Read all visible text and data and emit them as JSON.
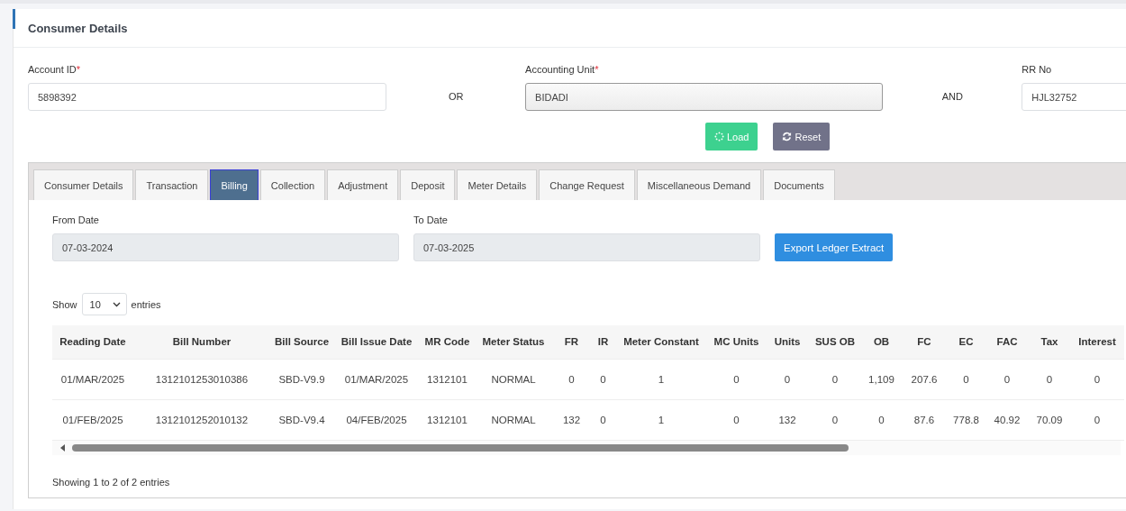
{
  "card": {
    "title": "Consumer Details"
  },
  "form": {
    "account_id": {
      "label": "Account ID",
      "required_mark": "*",
      "value": "5898392"
    },
    "or_text": "OR",
    "accounting_unit": {
      "label": "Accounting Unit",
      "required_mark": "*",
      "value": "BIDADI"
    },
    "and_text": "AND",
    "rr_no": {
      "label": "RR No",
      "value": "HJL32752"
    },
    "buttons": [
      {
        "kind": "load",
        "label": "Load"
      },
      {
        "kind": "reset",
        "label": "Reset"
      }
    ]
  },
  "tabs": [
    {
      "label": "Consumer Details",
      "selected": false
    },
    {
      "label": "Transaction",
      "selected": false
    },
    {
      "label": "Billing",
      "selected": true
    },
    {
      "label": "Collection",
      "selected": false
    },
    {
      "label": "Adjustment",
      "selected": false
    },
    {
      "label": "Deposit",
      "selected": false
    },
    {
      "label": "Meter Details",
      "selected": false
    },
    {
      "label": "Change Request",
      "selected": false
    },
    {
      "label": "Miscellaneous Demand",
      "selected": false
    },
    {
      "label": "Documents",
      "selected": false
    }
  ],
  "filters": {
    "from_date": {
      "label": "From Date",
      "value": "07-03-2024"
    },
    "to_date": {
      "label": "To Date",
      "value": "07-03-2025"
    },
    "export_button": "Export Ledger Extract"
  },
  "length_menu": {
    "show": "Show",
    "value": "10",
    "entries": "entries"
  },
  "table": {
    "columns": [
      "Reading Date",
      "Bill Number",
      "Bill Source",
      "Bill Issue Date",
      "MR Code",
      "Meter Status",
      "FR",
      "IR",
      "Meter Constant",
      "MC Units",
      "Units",
      "SUS OB",
      "OB",
      "FC",
      "EC",
      "FAC",
      "Tax",
      "Interest"
    ],
    "rows": [
      [
        "01/MAR/2025",
        "1312101253010386",
        "SBD-V9.9",
        "01/MAR/2025",
        "1312101",
        "NORMAL",
        "0",
        "0",
        "1",
        "0",
        "0",
        "0",
        "1,109",
        "207.6",
        "0",
        "0",
        "0",
        "0"
      ],
      [
        "01/FEB/2025",
        "1312101252010132",
        "SBD-V9.4",
        "04/FEB/2025",
        "1312101",
        "NORMAL",
        "132",
        "0",
        "1",
        "0",
        "132",
        "0",
        "0",
        "87.6",
        "778.8",
        "40.92",
        "70.09",
        "0"
      ]
    ]
  },
  "info": "Showing 1 to 2 of 2 entries"
}
